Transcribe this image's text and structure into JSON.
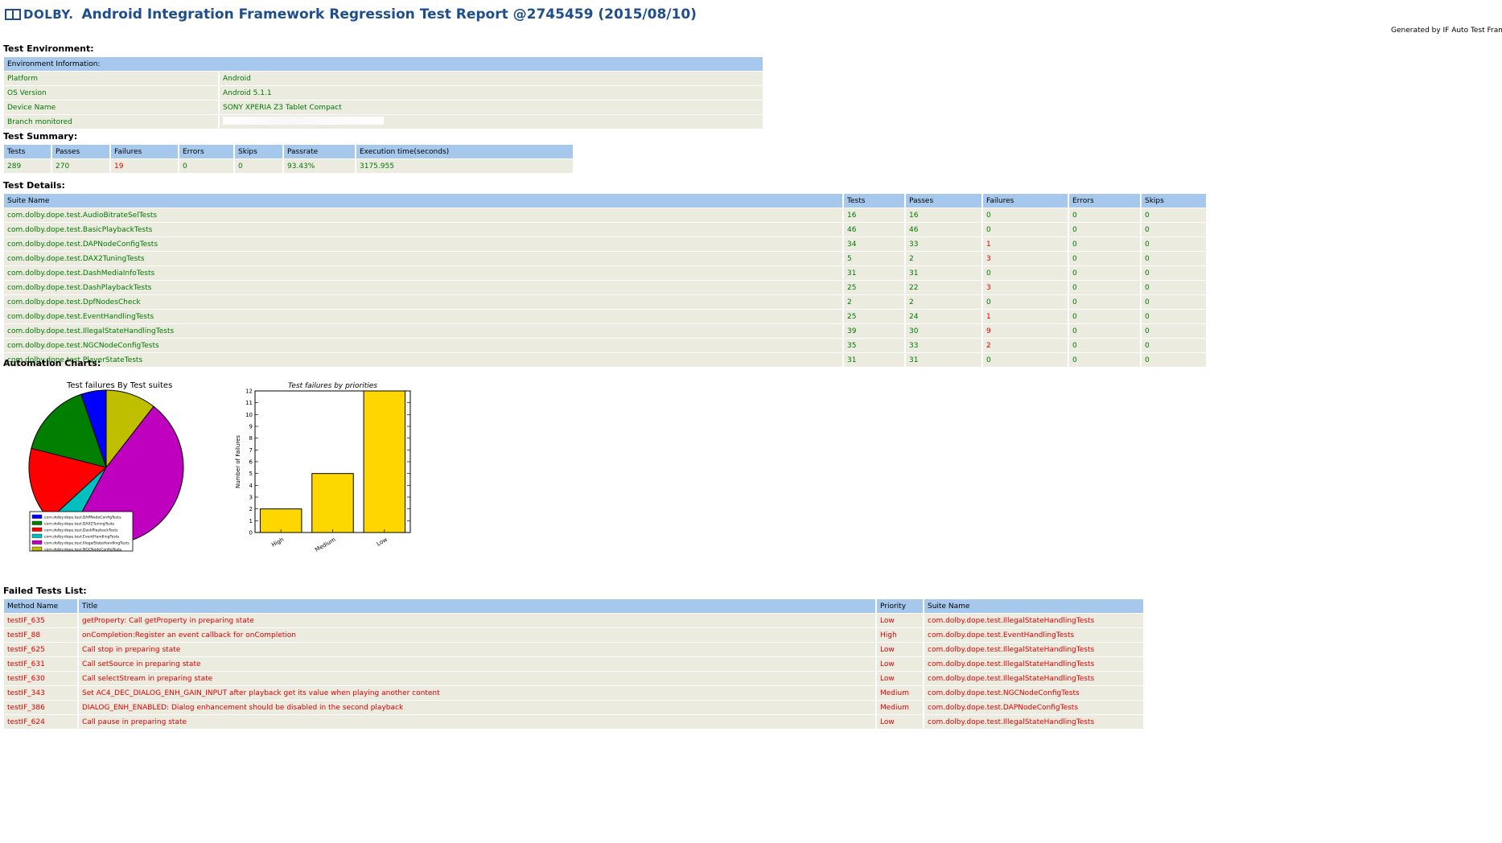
{
  "header": {
    "logo_text": "DOLBY.",
    "title": "Android Integration Framework Regression Test Report @2745459 (2015/08/10)",
    "generated_by": "Generated by IF Auto Test Framework"
  },
  "environment": {
    "section_title": "Test Environment:",
    "header": "Environment Information:",
    "rows": [
      {
        "label": "Platform",
        "value": "Android"
      },
      {
        "label": "OS Version",
        "value": "Android 5.1.1"
      },
      {
        "label": "Device Name",
        "value": "SONY XPERIA Z3 Tablet Compact"
      },
      {
        "label": "Branch monitored",
        "value": ""
      }
    ]
  },
  "summary": {
    "section_title": "Test Summary:",
    "headers": [
      "Tests",
      "Passes",
      "Failures",
      "Errors",
      "Skips",
      "Passrate",
      "Execution time(seconds)"
    ],
    "values": [
      "289",
      "270",
      "19",
      "0",
      "0",
      "93.43%",
      "3175.955"
    ]
  },
  "details": {
    "section_title": "Test Details:",
    "headers": [
      "Suite Name",
      "Tests",
      "Passes",
      "Failures",
      "Errors",
      "Skips"
    ],
    "rows": [
      [
        "com.dolby.dope.test.AudioBitrateSelTests",
        "16",
        "16",
        "0",
        "0",
        "0"
      ],
      [
        "com.dolby.dope.test.BasicPlaybackTests",
        "46",
        "46",
        "0",
        "0",
        "0"
      ],
      [
        "com.dolby.dope.test.DAPNodeConfigTests",
        "34",
        "33",
        "1",
        "0",
        "0"
      ],
      [
        "com.dolby.dope.test.DAX2TuningTests",
        "5",
        "2",
        "3",
        "0",
        "0"
      ],
      [
        "com.dolby.dope.test.DashMediaInfoTests",
        "31",
        "31",
        "0",
        "0",
        "0"
      ],
      [
        "com.dolby.dope.test.DashPlaybackTests",
        "25",
        "22",
        "3",
        "0",
        "0"
      ],
      [
        "com.dolby.dope.test.DpfNodesCheck",
        "2",
        "2",
        "0",
        "0",
        "0"
      ],
      [
        "com.dolby.dope.test.EventHandlingTests",
        "25",
        "24",
        "1",
        "0",
        "0"
      ],
      [
        "com.dolby.dope.test.IllegalStateHandlingTests",
        "39",
        "30",
        "9",
        "0",
        "0"
      ],
      [
        "com.dolby.dope.test.NGCNodeConfigTests",
        "35",
        "33",
        "2",
        "0",
        "0"
      ],
      [
        "com.dolby.dope.test.PlayerStateTests",
        "31",
        "31",
        "0",
        "0",
        "0"
      ]
    ]
  },
  "charts": {
    "section_title": "Automation Charts:"
  },
  "chart_data": [
    {
      "type": "pie",
      "title": "Test failures By Test suites",
      "categories": [
        "com.dolby.dope.test.DAPNodeConfigTests",
        "com.dolby.dope.test.DAX2TuningTests",
        "com.dolby.dope.test.DashPlaybackTests",
        "com.dolby.dope.test.EventHandlingTests",
        "com.dolby.dope.test.IllegalStateHandlingTests",
        "com.dolby.dope.test.NGCNodeConfigTests"
      ],
      "values": [
        1,
        3,
        3,
        1,
        9,
        2
      ],
      "colors": [
        "#0000ff",
        "#007f00",
        "#ff0000",
        "#00bfbf",
        "#bf00bf",
        "#bfbf00"
      ],
      "legend": "bottom-left"
    },
    {
      "type": "bar",
      "title": "Test failures by priorities",
      "categories": [
        "High",
        "Medium",
        "Low"
      ],
      "values": [
        2,
        5,
        12
      ],
      "ylabel": "Number of Failures",
      "ylim": [
        0,
        12
      ],
      "yticks": [
        "0",
        "1",
        "2",
        "3",
        "4",
        "5",
        "6",
        "7",
        "8",
        "9",
        "10",
        "11",
        "12"
      ],
      "color": "#ffd700",
      "grid": false
    }
  ],
  "failed": {
    "section_title": "Failed Tests List:",
    "headers": [
      "Method Name",
      "Title",
      "Priority",
      "Suite Name"
    ],
    "rows": [
      [
        "testIF_635",
        "getProperty: Call getProperty in preparing state",
        "Low",
        "com.dolby.dope.test.IllegalStateHandlingTests"
      ],
      [
        "testIF_88",
        "onCompletion:Register an event callback for onCompletion",
        "High",
        "com.dolby.dope.test.EventHandlingTests"
      ],
      [
        "testIF_625",
        "Call stop in preparing state",
        "Low",
        "com.dolby.dope.test.IllegalStateHandlingTests"
      ],
      [
        "testIF_631",
        "Call setSource in preparing state",
        "Low",
        "com.dolby.dope.test.IllegalStateHandlingTests"
      ],
      [
        "testIF_630",
        "Call selectStream in preparing state",
        "Low",
        "com.dolby.dope.test.IllegalStateHandlingTests"
      ],
      [
        "testIF_343",
        "Set AC4_DEC_DIALOG_ENH_GAIN_INPUT after playback get its value when playing another content",
        "Medium",
        "com.dolby.dope.test.NGCNodeConfigTests"
      ],
      [
        "testIF_386",
        "DIALOG_ENH_ENABLED: Dialog enhancement should be disabled in the second playback",
        "Medium",
        "com.dolby.dope.test.DAPNodeConfigTests"
      ],
      [
        "testIF_624",
        "Call pause in preparing state",
        "Low",
        "com.dolby.dope.test.IllegalStateHandlingTests"
      ]
    ]
  }
}
